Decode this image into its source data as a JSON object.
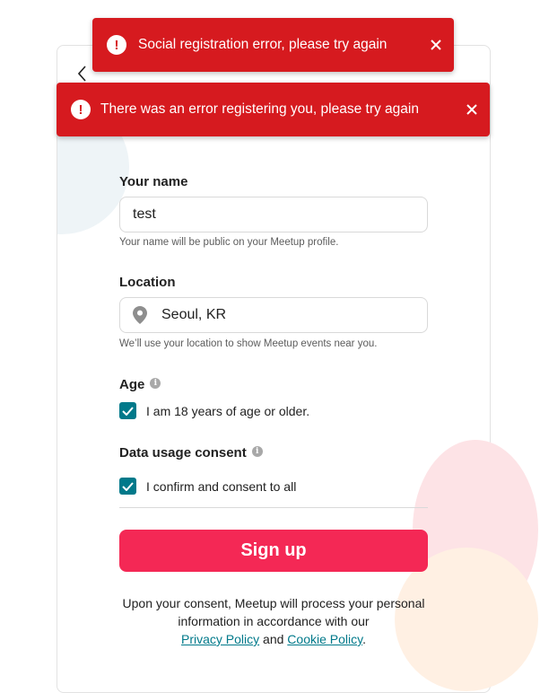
{
  "toasts": [
    {
      "message": "Social registration error, please try again",
      "icon": "alert-icon",
      "close_icon": "close-icon"
    },
    {
      "message": "There was an error registering you, please try again",
      "icon": "alert-icon",
      "close_icon": "close-icon"
    }
  ],
  "form": {
    "name": {
      "label": "Your name",
      "value": "test",
      "hint": "Your name will be public on your Meetup profile."
    },
    "location": {
      "label": "Location",
      "value": "Seoul, KR",
      "icon": "location-pin-icon",
      "hint": "We’ll use your location to show Meetup events near you."
    },
    "age": {
      "label": "Age",
      "checkbox_label": "I am 18 years of age or older.",
      "checked": true
    },
    "consent": {
      "label": "Data usage consent",
      "checkbox_label": "I confirm and consent to all",
      "checked": true
    },
    "submit_label": "Sign up"
  },
  "footer": {
    "text_before": "Upon your consent, Meetup will process your personal information in accordance with our",
    "privacy_link": "Privacy Policy",
    "conjunction": "and",
    "cookie_link": "Cookie Policy",
    "end": "."
  },
  "colors": {
    "error": "#d61a1f",
    "accent": "#00798a",
    "primary_button": "#f42855"
  }
}
